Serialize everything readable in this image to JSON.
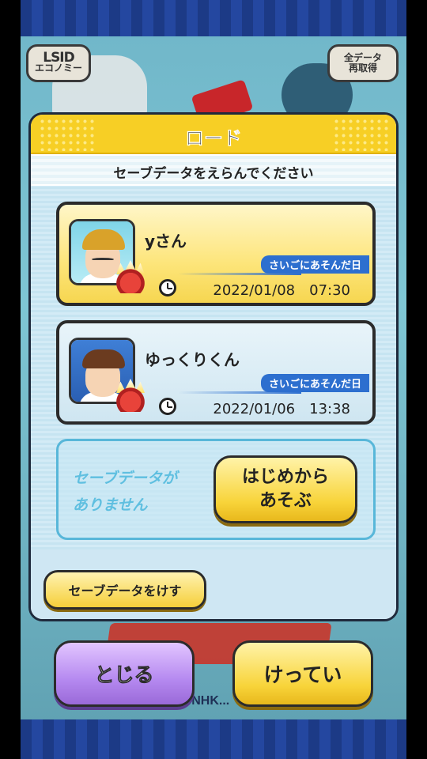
{
  "background": {
    "corner_left": {
      "logo": "LSID",
      "label": "エコノミー"
    },
    "corner_right": {
      "line1": "全データ",
      "line2": "再取得"
    },
    "copyright": "© NHK..."
  },
  "modal": {
    "title": "ロード",
    "subtitle": "セーブデータをえらんでください",
    "slots": [
      {
        "name": "yさん",
        "last_played_label": "さいごにあそんだ日",
        "datetime": "2022/01/08　07:30"
      },
      {
        "name": "ゆっくりくん",
        "last_played_label": "さいごにあそんだ日",
        "datetime": "2022/01/06　13:38"
      }
    ],
    "empty_slot": {
      "message_line1": "セーブデータが",
      "message_line2": "ありません",
      "start_line1": "はじめから",
      "start_line2": "あそぶ"
    },
    "delete_label": "セーブデータをけす"
  },
  "buttons": {
    "close": "とじる",
    "confirm": "けってい"
  },
  "colors": {
    "header_yellow": "#f7cf25",
    "pill_blue": "#2d6fcf",
    "close_purple": "#b589f0",
    "confirm_yellow": "#f8d43a"
  }
}
